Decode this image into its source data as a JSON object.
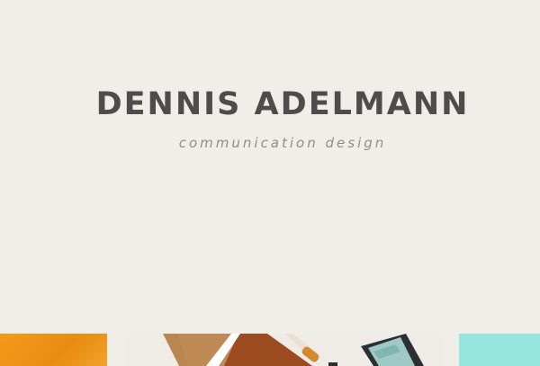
{
  "header": {
    "title": "DENNIS ADELMANN",
    "subtitle": "communication design"
  },
  "portfolio": {
    "tiles": [
      {
        "name": "orange",
        "color": "#f39a1c"
      },
      {
        "name": "stationery-photo",
        "color": "#efece7"
      },
      {
        "name": "cyan",
        "color": "#96e6de"
      }
    ]
  }
}
